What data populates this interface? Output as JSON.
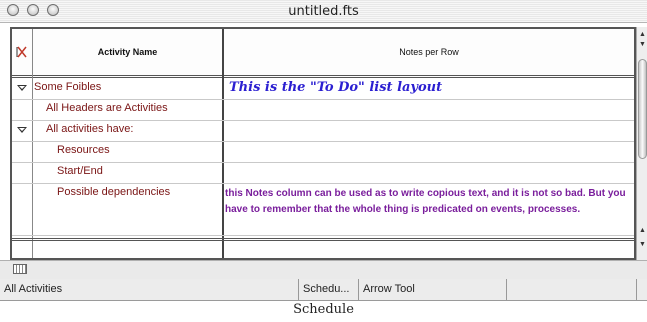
{
  "window": {
    "title": "untitled.fts"
  },
  "table": {
    "columns": [
      "Activity Name",
      "Notes per Row"
    ],
    "rows": [
      {
        "activity": "Some Foibles",
        "note": "This is the \"To Do\" list layout"
      },
      {
        "activity": "All Headers are Activities",
        "note": ""
      },
      {
        "activity": "All activities have:",
        "note": ""
      },
      {
        "activity": "Resources",
        "note": ""
      },
      {
        "activity": "Start/End",
        "note": ""
      },
      {
        "activity": "Possible dependencies",
        "note": "this Notes column can be used as to write copious text, and it is not so bad. But you have to remember that the whole thing is predicated on events, processes."
      }
    ]
  },
  "statusbar": {
    "view": "All Activities",
    "tab": "Schedu...",
    "tool": "Arrow Tool"
  },
  "caption": "Schedule"
}
